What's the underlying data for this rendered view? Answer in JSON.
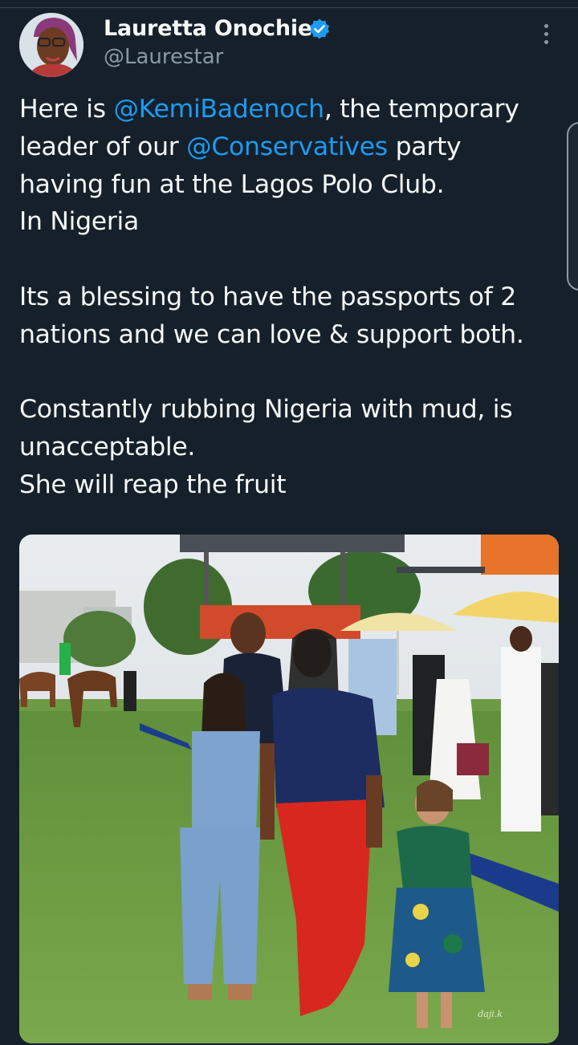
{
  "author": {
    "display_name": "Lauretta Onochie",
    "handle": "@Laurestar",
    "verified": true,
    "avatar_icon": "profile-photo"
  },
  "tweet": {
    "p1_a": "Here is ",
    "p1_mention1": "@KemiBadenoch",
    "p1_b": ", the temporary",
    "p1_c": "leader of our ",
    "p1_mention2": "@Conservatives",
    "p1_d": " party",
    "p1_e": "having fun at the Lagos Polo Club.",
    "p1_f": "In Nigeria",
    "p2_a": "Its a blessing to have the passports of 2",
    "p2_b": "nations and we can love & support both.",
    "p3_a": "Constantly rubbing Nigeria with mud, is",
    "p3_b": "unacceptable.",
    "p3_c": "She will reap the fruit"
  },
  "media": {
    "watermark": "daji.k"
  },
  "colors": {
    "background": "#15202b",
    "text": "#f7f9f9",
    "secondary_text": "#8b98a5",
    "link": "#1d9bf0",
    "verified_badge": "#1d9bf0"
  }
}
